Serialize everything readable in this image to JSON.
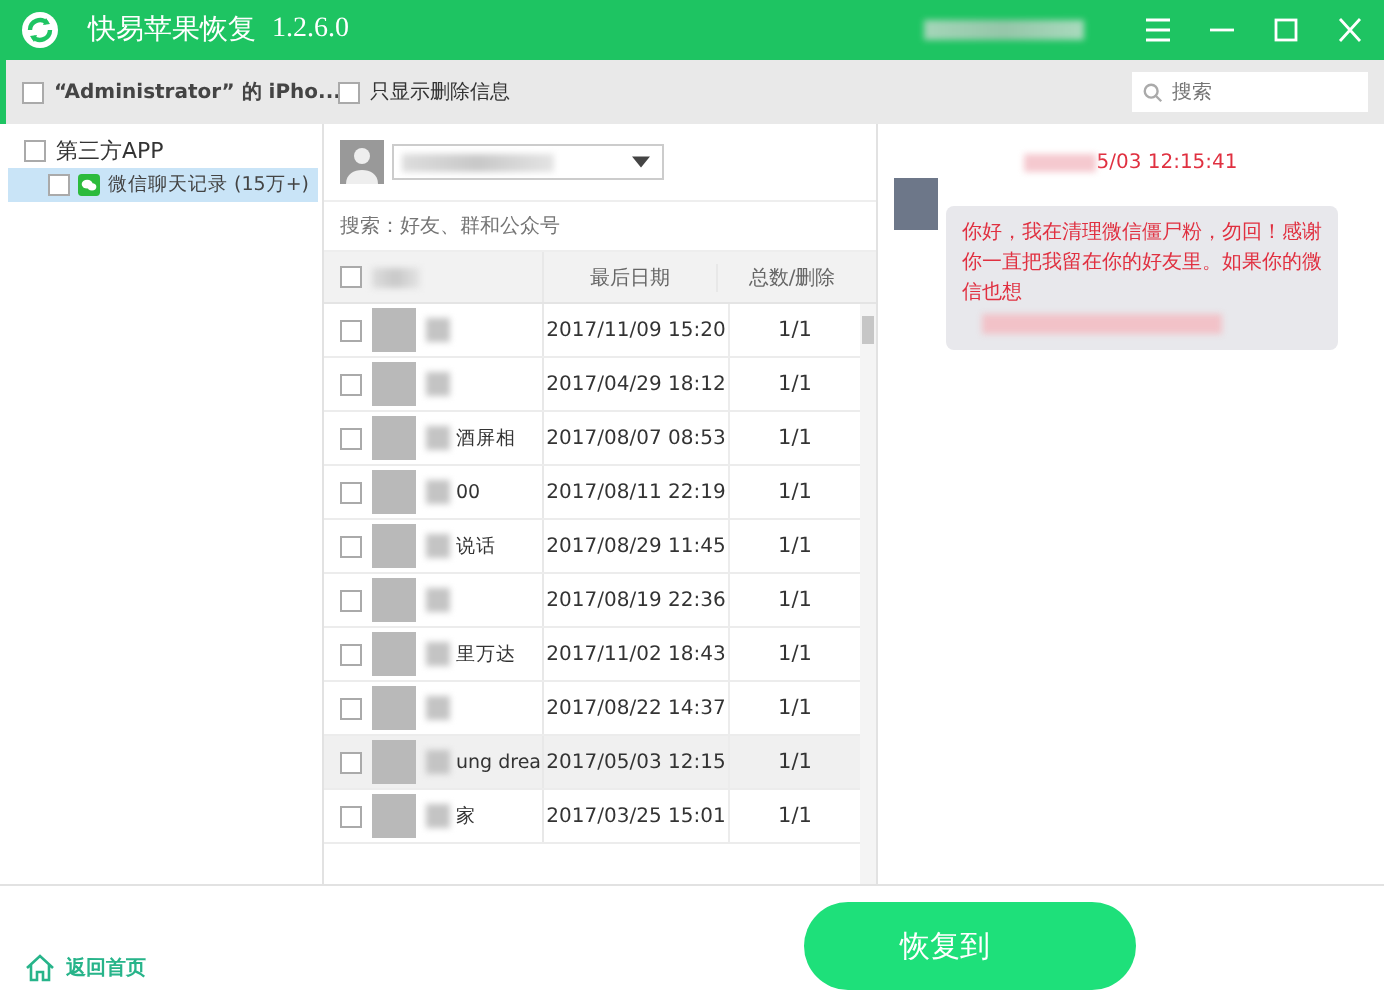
{
  "window": {
    "title": "快易苹果恢复",
    "version": "1.2.6.0"
  },
  "toolbar": {
    "device": {
      "label": "“Administrator” 的 iPho...",
      "checked": false
    },
    "filter": {
      "label": "只显示删除信息",
      "checked": false
    },
    "search": {
      "placeholder": "搜索"
    }
  },
  "tree": [
    {
      "label": "第三方APP",
      "checked": false,
      "selected": false,
      "children": [
        {
          "label": "微信聊天记录 (15万+)",
          "checked": false,
          "selected": true
        }
      ]
    }
  ],
  "contacts": {
    "search": {
      "placeholder": "搜索：好友、群和公众号"
    },
    "columns": [
      "最后日期",
      "总数/删除"
    ],
    "all_checked": false,
    "rows": [
      {
        "name": "",
        "date": "2017/11/09 15:20",
        "count": "1/1",
        "selected": false,
        "checked": false
      },
      {
        "name": "",
        "date": "2017/04/29 18:12",
        "count": "1/1",
        "selected": false,
        "checked": false
      },
      {
        "name": "酒屏相",
        "date": "2017/08/07 08:53",
        "count": "1/1",
        "selected": false,
        "checked": false
      },
      {
        "name": "00",
        "date": "2017/08/11 22:19",
        "count": "1/1",
        "selected": false,
        "checked": false
      },
      {
        "name": "说话",
        "date": "2017/08/29 11:45",
        "count": "1/1",
        "selected": false,
        "checked": false
      },
      {
        "name": "",
        "date": "2017/08/19 22:36",
        "count": "1/1",
        "selected": false,
        "checked": false
      },
      {
        "name": "里万达",
        "date": "2017/11/02 18:43",
        "count": "1/1",
        "selected": false,
        "checked": false
      },
      {
        "name": "",
        "date": "2017/08/22 14:37",
        "count": "1/1",
        "selected": false,
        "checked": false
      },
      {
        "name": "ung drea",
        "date": "2017/05/03 12:15",
        "count": "1/1",
        "selected": true,
        "checked": false
      },
      {
        "name": "家",
        "date": "2017/03/25 15:01",
        "count": "1/1",
        "selected": false,
        "checked": false
      }
    ]
  },
  "chat": {
    "time": "5/03 12:15:41",
    "message": "你好，我在清理微信僵尸粉，勿回！感谢你一直把我留在你的好友里。如果你的微信也想"
  },
  "footer": {
    "home_link": "返回首页",
    "recover_button": "恢复到"
  }
}
